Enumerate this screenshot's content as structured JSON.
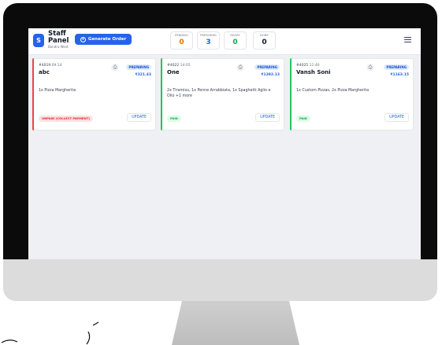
{
  "header": {
    "logo_letter": "S",
    "title": "Staff Panel",
    "subtitle": "Bandra West",
    "generate_label": "Generate Order",
    "plus_icon": "+"
  },
  "stats": [
    {
      "label": "PENDING",
      "value": "0",
      "color": "#d97706"
    },
    {
      "label": "PREPARING",
      "value": "3",
      "color": "#2563eb"
    },
    {
      "label": "READY",
      "value": "0",
      "color": "#16a34a"
    },
    {
      "label": "DONE",
      "value": "0",
      "color": "#111827"
    }
  ],
  "orders": [
    {
      "id": "#4019",
      "time": "09:14",
      "name": "abc",
      "status": "PREPARING",
      "price": "₹321.43",
      "items": "1x Pizza Margherita",
      "payment": "UNPAID (COLLECT PAYMENT)",
      "update": "UPDATE",
      "accent": "#ef4444",
      "pay_bg": "#fee2e2",
      "pay_color": "#dc2626"
    },
    {
      "id": "#4022",
      "time": "14:05",
      "name": "One",
      "status": "PREPARING",
      "price": "₹1392.13",
      "items": "2x Tiramisu, 1x Penne Arrabbiata, 1x Spaghetti Aglio e Olio +1 more",
      "payment": "PAID",
      "update": "UPDATE",
      "accent": "#22c55e",
      "pay_bg": "#dcfce7",
      "pay_color": "#16a34a"
    },
    {
      "id": "#4025",
      "time": "11:46",
      "name": "Vansh Soni",
      "status": "PREPARING",
      "price": "₹1163.15",
      "items": "1x Custom Pizzas, 2x Pizza Margherita",
      "payment": "PAID",
      "update": "UPDATE",
      "accent": "#22c55e",
      "pay_bg": "#dcfce7",
      "pay_color": "#16a34a"
    }
  ],
  "icons": {
    "print": "printer-icon",
    "menu": "hamburger-menu-icon",
    "plus": "plus-circle-icon"
  }
}
